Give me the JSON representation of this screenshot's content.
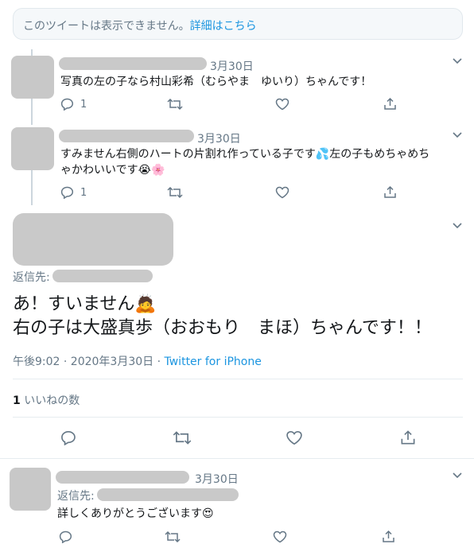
{
  "notice": {
    "text": "このツイートは表示できません。",
    "link": "詳細はこちら"
  },
  "tweets": [
    {
      "date": "3月30日",
      "text": "写真の左の子なら村山彩希（むらやま　ゆいり）ちゃんです！",
      "reply_count": "1"
    },
    {
      "date": "3月30日",
      "line1": "すみません右側のハートの片割れ作っている子です💦左の子もめちゃめち",
      "line2": "ゃかわいいです😭🌸",
      "reply_count": "1"
    }
  ],
  "focused": {
    "reply_label": "返信先:",
    "line1": "あ！すいません🙇",
    "line2": "右の子は大盛真歩（おおもり　まほ）ちゃんです！！",
    "time": "午後9:02 · 2020年3月30日 · ",
    "source": "Twitter for iPhone",
    "likes_count": "1",
    "likes_label": "いいねの数"
  },
  "last": {
    "date": "3月30日",
    "reply_label": "返信先:",
    "text": "詳しくありがとうございます😍"
  }
}
